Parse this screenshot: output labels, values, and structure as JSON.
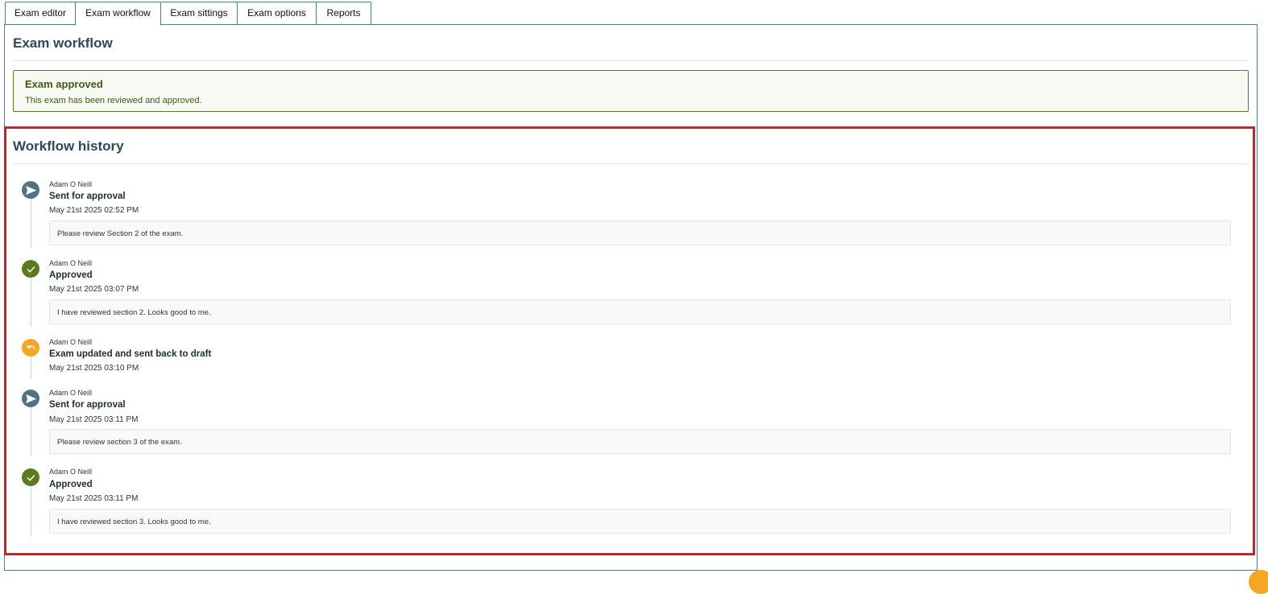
{
  "tabs": [
    {
      "label": "Exam editor",
      "active": false
    },
    {
      "label": "Exam workflow",
      "active": true
    },
    {
      "label": "Exam sittings",
      "active": false
    },
    {
      "label": "Exam options",
      "active": false
    },
    {
      "label": "Reports",
      "active": false
    }
  ],
  "page": {
    "title": "Exam workflow"
  },
  "alert": {
    "title": "Exam approved",
    "text": "This exam has been reviewed and approved."
  },
  "history": {
    "title": "Workflow history",
    "entries": [
      {
        "user": "Adam O Neill",
        "action": "Sent for approval",
        "time": "May 21st 2025 02:52 PM",
        "comment": "Please review Section 2 of the exam.",
        "icon": "send-icon",
        "color": "#4f7380"
      },
      {
        "user": "Adam O Neill",
        "action": "Approved",
        "time": "May 21st 2025 03:07 PM",
        "comment": "I have reviewed section 2. Looks good to me.",
        "icon": "check-icon",
        "color": "#5a7a1e"
      },
      {
        "user": "Adam O Neill",
        "action": "Exam updated and sent back to draft",
        "time": "May 21st 2025 03:10 PM",
        "comment": "",
        "icon": "undo-icon",
        "color": "#f5a623"
      },
      {
        "user": "Adam O Neill",
        "action": "Sent for approval",
        "time": "May 21st 2025 03:11 PM",
        "comment": "Please review section 3 of the exam.",
        "icon": "send-icon",
        "color": "#4f7380"
      },
      {
        "user": "Adam O Neill",
        "action": "Approved",
        "time": "May 21st 2025 03:11 PM",
        "comment": "I have reviewed section 3. Looks good to me.",
        "icon": "check-icon",
        "color": "#5a7a1e"
      }
    ]
  },
  "colors": {
    "accent": "#4f7d88",
    "highlight": "#e0171f",
    "success": "#5a7a1e",
    "warning": "#f5a623"
  }
}
